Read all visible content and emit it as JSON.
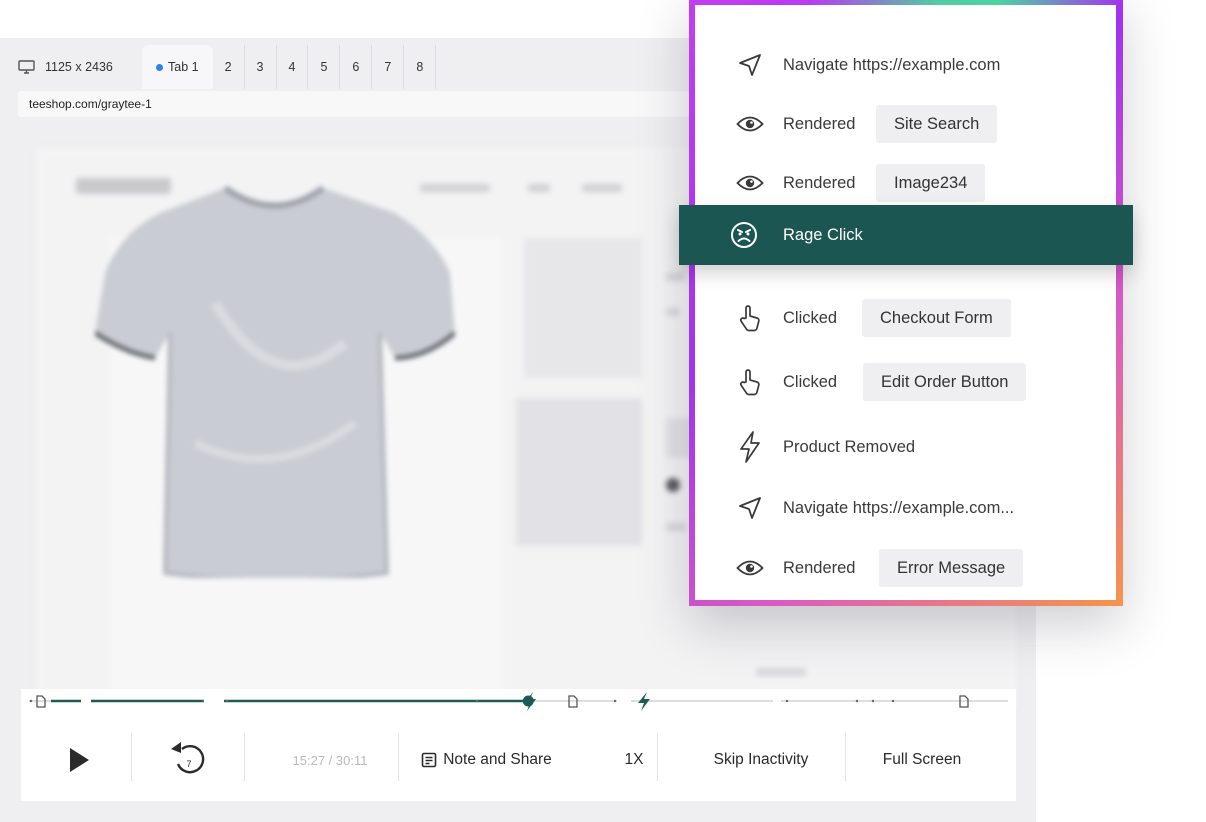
{
  "player": {
    "device_size": "1125 x 2436",
    "tabs": [
      {
        "label": "Tab 1",
        "active": true
      },
      {
        "label": "2"
      },
      {
        "label": "3"
      },
      {
        "label": "4"
      },
      {
        "label": "5"
      },
      {
        "label": "6"
      },
      {
        "label": "7"
      },
      {
        "label": "8"
      }
    ],
    "url": "teeshop.com/graytee-1",
    "rewind_seconds": "7",
    "time": "15:27 / 30:11",
    "progress_fraction": 0.51,
    "note_share_label": "Note and Share",
    "speed_label": "1X",
    "skip_inactivity_label": "Skip Inactivity",
    "full_screen_label": "Full Screen"
  },
  "events": [
    {
      "icon": "navigate-icon",
      "label": "Navigate https://example.com",
      "tag": ""
    },
    {
      "icon": "eye-icon",
      "label": "Rendered",
      "tag": "Site Search"
    },
    {
      "icon": "eye-icon",
      "label": "Rendered",
      "tag": "Image234"
    },
    {
      "icon": "rage-face-icon",
      "label": "Rage Click",
      "tag": "",
      "highlighted": true
    },
    {
      "icon": "pointer-hand-icon",
      "label": "Clicked",
      "tag": "Checkout Form"
    },
    {
      "icon": "pointer-hand-icon",
      "label": "Clicked",
      "tag": "Edit Order Button"
    },
    {
      "icon": "lightning-icon",
      "label": "Product Removed",
      "tag": ""
    },
    {
      "icon": "navigate-icon",
      "label": "Navigate https://example.com...",
      "tag": ""
    },
    {
      "icon": "eye-icon",
      "label": "Rendered",
      "tag": "Error Message"
    }
  ],
  "colors": {
    "accent_green": "#1b5652",
    "progress": "#1e5a55",
    "panel_bg": "#efeff1"
  }
}
